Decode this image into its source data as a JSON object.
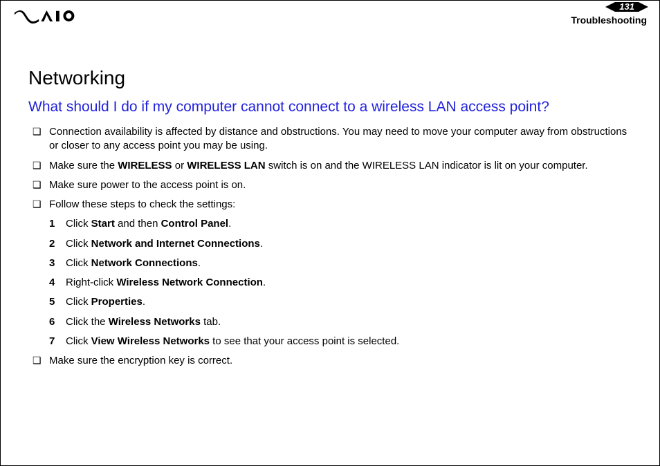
{
  "header": {
    "page_number": "131",
    "breadcrumb": "Troubleshooting"
  },
  "h1": "Networking",
  "h2": "What should I do if my computer cannot connect to a wireless LAN access point?",
  "bullets": [
    {
      "html": "Connection availability is affected by distance and obstructions. You may need to move your computer away from obstructions or closer to any access point you may be using."
    },
    {
      "html": "Make sure the <b>WIRELESS</b> or <b>WIRELESS LAN</b> switch is on and the WIRELESS LAN indicator is lit on your computer."
    },
    {
      "html": "Make sure power to the access point is on."
    },
    {
      "html": "Follow these steps to check the settings:"
    }
  ],
  "steps": [
    {
      "n": "1",
      "html": "Click <b>Start</b> and then <b>Control Panel</b>."
    },
    {
      "n": "2",
      "html": "Click <b>Network and Internet Connections</b>."
    },
    {
      "n": "3",
      "html": "Click <b>Network Connections</b>."
    },
    {
      "n": "4",
      "html": "Right-click <b>Wireless Network Connection</b>."
    },
    {
      "n": "5",
      "html": "Click <b>Properties</b>."
    },
    {
      "n": "6",
      "html": "Click the <b>Wireless Networks</b> tab."
    },
    {
      "n": "7",
      "html": "Click <b>View Wireless Networks</b> to see that your access point is selected."
    }
  ],
  "bullets_after": [
    {
      "html": "Make sure the encryption key is correct."
    }
  ]
}
